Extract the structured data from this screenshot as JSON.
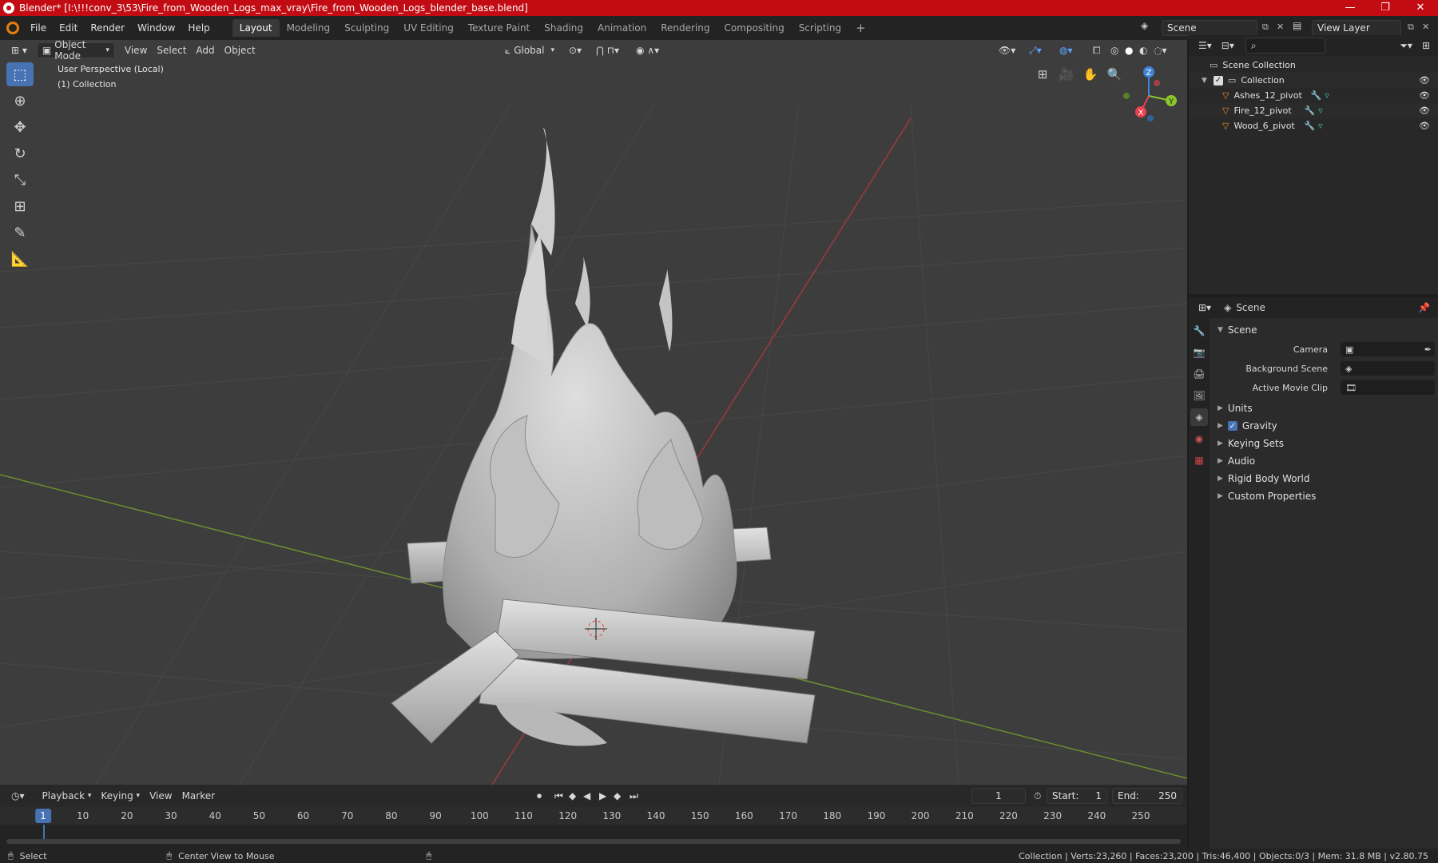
{
  "window": {
    "title": "Blender* [I:\\!!!conv_3\\53\\Fire_from_Wooden_Logs_max_vray\\Fire_from_Wooden_Logs_blender_base.blend]",
    "controls": [
      "—",
      "❐",
      "✕"
    ]
  },
  "menubar": {
    "menus": [
      "File",
      "Edit",
      "Render",
      "Window",
      "Help"
    ],
    "workspaces": [
      "Layout",
      "Modeling",
      "Sculpting",
      "UV Editing",
      "Texture Paint",
      "Shading",
      "Animation",
      "Rendering",
      "Compositing",
      "Scripting"
    ],
    "active_workspace": "Layout",
    "add_tab": "+",
    "scene": "Scene",
    "view_layer": "View Layer"
  },
  "viewport": {
    "mode": "Object Mode",
    "menus": [
      "View",
      "Select",
      "Add",
      "Object"
    ],
    "transform_orientation": "Global",
    "overlay_line1": "User Perspective (Local)",
    "overlay_line2": "(1) Collection",
    "gizmo_axes": {
      "x": "X",
      "y": "Y",
      "z": "Z"
    },
    "axis_colors": {
      "x": "#e8414f",
      "y": "#8ac628",
      "z": "#3f84d6"
    }
  },
  "timeline": {
    "menus": [
      "Playback",
      "Keying",
      "View",
      "Marker"
    ],
    "current_frame": "1",
    "start_label": "Start:",
    "start": "1",
    "end_label": "End:",
    "end": "250",
    "ticks": [
      "10",
      "20",
      "30",
      "40",
      "50",
      "60",
      "70",
      "80",
      "90",
      "100",
      "110",
      "120",
      "130",
      "140",
      "150",
      "160",
      "170",
      "180",
      "190",
      "200",
      "210",
      "220",
      "230",
      "240",
      "250"
    ],
    "cursor_frame": "1"
  },
  "statusbar": {
    "select": "Select",
    "center_view": "Center View to Mouse",
    "stats": "Collection | Verts:23,260 | Faces:23,200 | Tris:46,400 | Objects:0/3 | Mem: 31.8 MB | v2.80.75"
  },
  "outliner": {
    "root": "Scene Collection",
    "collection": "Collection",
    "objects": [
      "Ashes_12_pivot",
      "Fire_12_pivot",
      "Wood_6_pivot"
    ]
  },
  "properties": {
    "context": "Scene",
    "panel": "Scene",
    "fields": [
      {
        "label": "Camera",
        "value": ""
      },
      {
        "label": "Background Scene",
        "value": ""
      },
      {
        "label": "Active Movie Clip",
        "value": ""
      }
    ],
    "sections": [
      "Units",
      "Gravity",
      "Keying Sets",
      "Audio",
      "Rigid Body World",
      "Custom Properties"
    ],
    "accent": "#4772b3"
  }
}
